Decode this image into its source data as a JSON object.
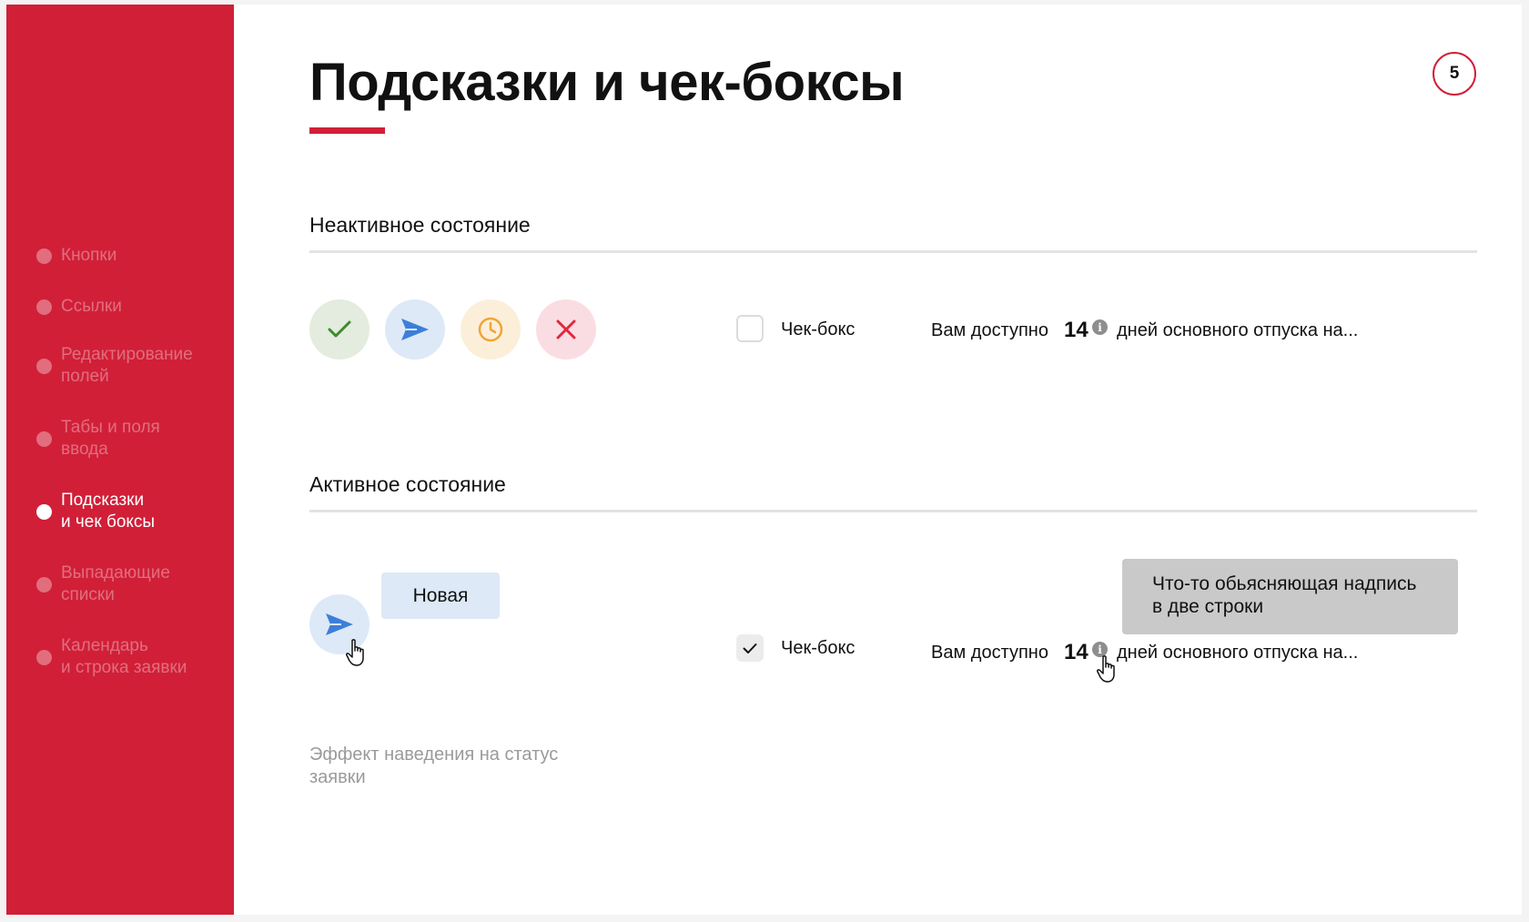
{
  "sidebar": {
    "items": [
      {
        "label": "Кнопки",
        "active": false
      },
      {
        "label": "Ссылки",
        "active": false
      },
      {
        "label": "Редактирование\nполей",
        "active": false
      },
      {
        "label": "Табы и поля\nввода",
        "active": false
      },
      {
        "label": "Подсказки\nи чек боксы",
        "active": true
      },
      {
        "label": "Выпадающие\nсписки",
        "active": false
      },
      {
        "label": "Календарь\nи строка заявки",
        "active": false
      }
    ]
  },
  "header": {
    "title": "Подсказки и чек-боксы",
    "page_number": "5"
  },
  "inactive": {
    "section_title": "Неактивное состояние",
    "status_icons": [
      "check-icon",
      "send-icon",
      "clock-icon",
      "close-icon"
    ],
    "checkbox": {
      "label": "Чек-бокс",
      "checked": false
    },
    "vacation": {
      "prefix": "Вам доступно",
      "days": "14",
      "suffix": "дней основного отпуска на..."
    }
  },
  "active": {
    "section_title": "Активное состояние",
    "status_tag": "Новая",
    "checkbox": {
      "label": "Чек-бокс",
      "checked": true
    },
    "vacation": {
      "prefix": "Вам доступно",
      "days": "14",
      "suffix": "дней основного отпуска на..."
    },
    "tooltip": "Что-то обьясняющая надпись\nв две строки",
    "caption": "Эффект наведения на статус\nзаявки"
  },
  "colors": {
    "brand_red": "#d11f38",
    "ok_green": "#3e8b2e",
    "send_blue": "#3b7fd9",
    "wait_orange": "#f0a43a",
    "reject_red": "#e0283f"
  }
}
